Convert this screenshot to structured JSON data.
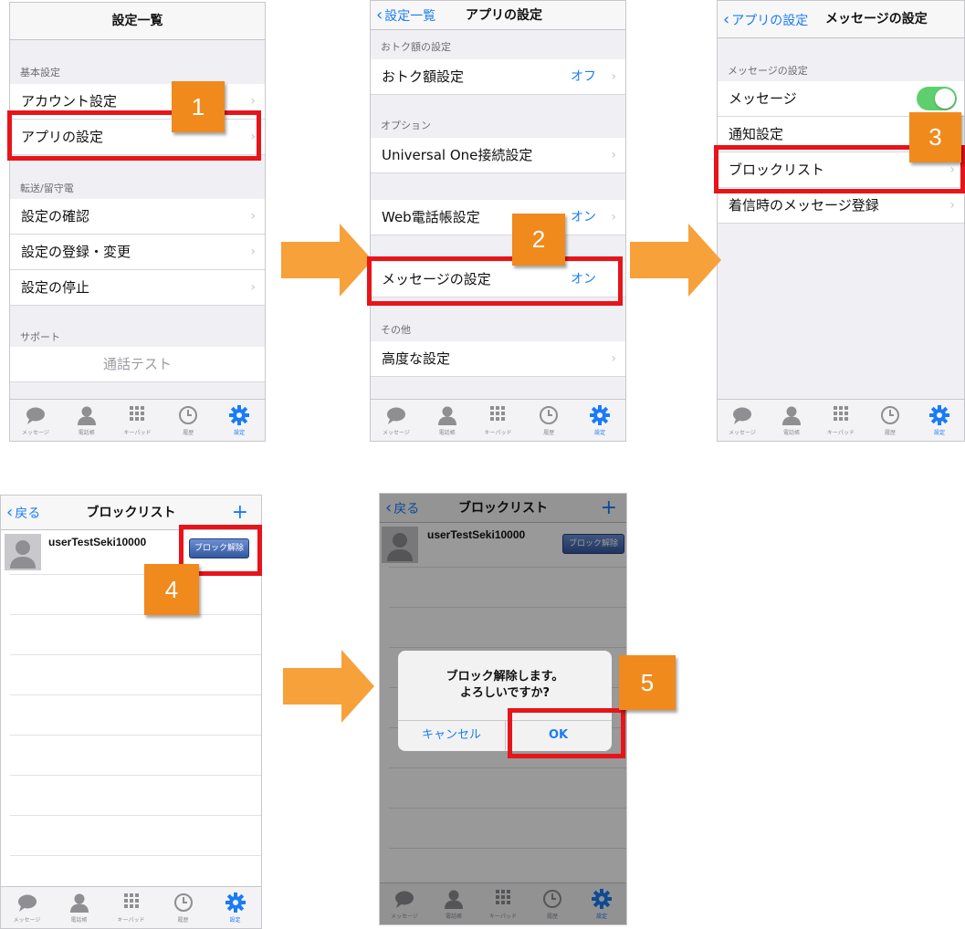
{
  "colors": {
    "accent": "#1a7cf5",
    "highlight": "#e7141a",
    "badge": "#f08a1d",
    "arrow": "#f7a13b",
    "toggle_on": "#5fcf6e"
  },
  "tabbar": {
    "items": [
      "メッセージ",
      "電話帳",
      "キーパッド",
      "履歴",
      "設定"
    ],
    "active": "設定"
  },
  "screen1": {
    "title": "設定一覧",
    "section_basic": "基本設定",
    "account": "アカウント設定",
    "app_settings": "アプリの設定",
    "section_forward": "転送/留守電",
    "confirm": "設定の確認",
    "register": "設定の登録・変更",
    "stop": "設定の停止",
    "section_support": "サポート",
    "call_test": "通話テスト",
    "step": "1"
  },
  "screen2": {
    "back": "設定一覧",
    "title": "アプリの設定",
    "section_otoku": "おトク額の設定",
    "otoku": "おトク額設定",
    "otoku_value": "オフ",
    "section_option": "オプション",
    "universal": "Universal One接続設定",
    "web_phonebook": "Web電話帳設定",
    "web_phonebook_value": "オン",
    "message_settings": "メッセージの設定",
    "message_settings_value": "オン",
    "section_other": "その他",
    "advanced": "高度な設定",
    "step": "2"
  },
  "screen3": {
    "back": "アプリの設定",
    "title": "メッセージの設定",
    "section_message": "メッセージの設定",
    "message": "メッセージ",
    "message_on": true,
    "notification": "通知設定",
    "blocklist": "ブロックリスト",
    "incoming_register": "着信時のメッセージ登録",
    "step": "3"
  },
  "screen4": {
    "back": "戻る",
    "title": "ブロックリスト",
    "add": "+",
    "user": "userTestSeki10000",
    "unblock": "ブロック解除",
    "step": "4"
  },
  "screen5": {
    "back": "戻る",
    "title": "ブロックリスト",
    "add": "+",
    "user": "userTestSeki10000",
    "unblock": "ブロック解除",
    "alert_line1": "ブロック解除します。",
    "alert_line2": "よろしいですか?",
    "cancel": "キャンセル",
    "ok": "OK",
    "step": "5"
  }
}
